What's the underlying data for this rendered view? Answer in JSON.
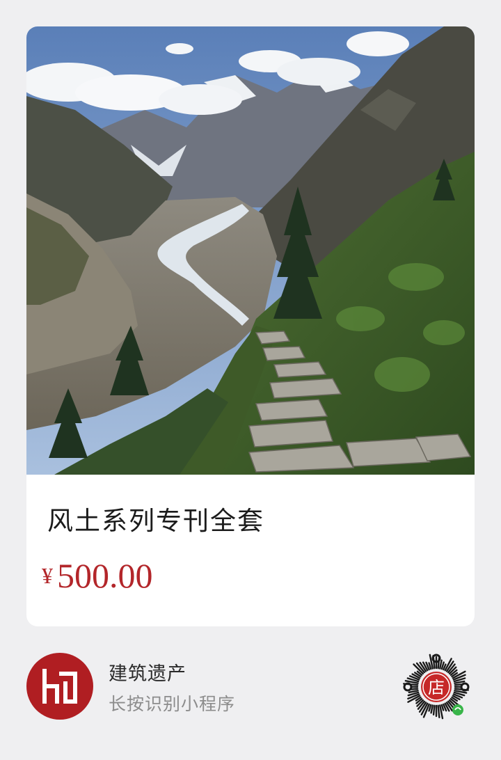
{
  "product": {
    "image_alt": "Mountain valley with a glacier and a stone hiking trail",
    "title": "风土系列专刊全套",
    "currency": "¥",
    "price": "500.00"
  },
  "store": {
    "logo_icon": "store-logo-icon",
    "name": "建筑遗产",
    "hint": "长按识别小程序",
    "code_icon": "mini-program-code-icon",
    "code_center_text": "店"
  },
  "colors": {
    "price": "#b3262a",
    "logo_bg": "#b01e22",
    "background": "#efeff1"
  }
}
